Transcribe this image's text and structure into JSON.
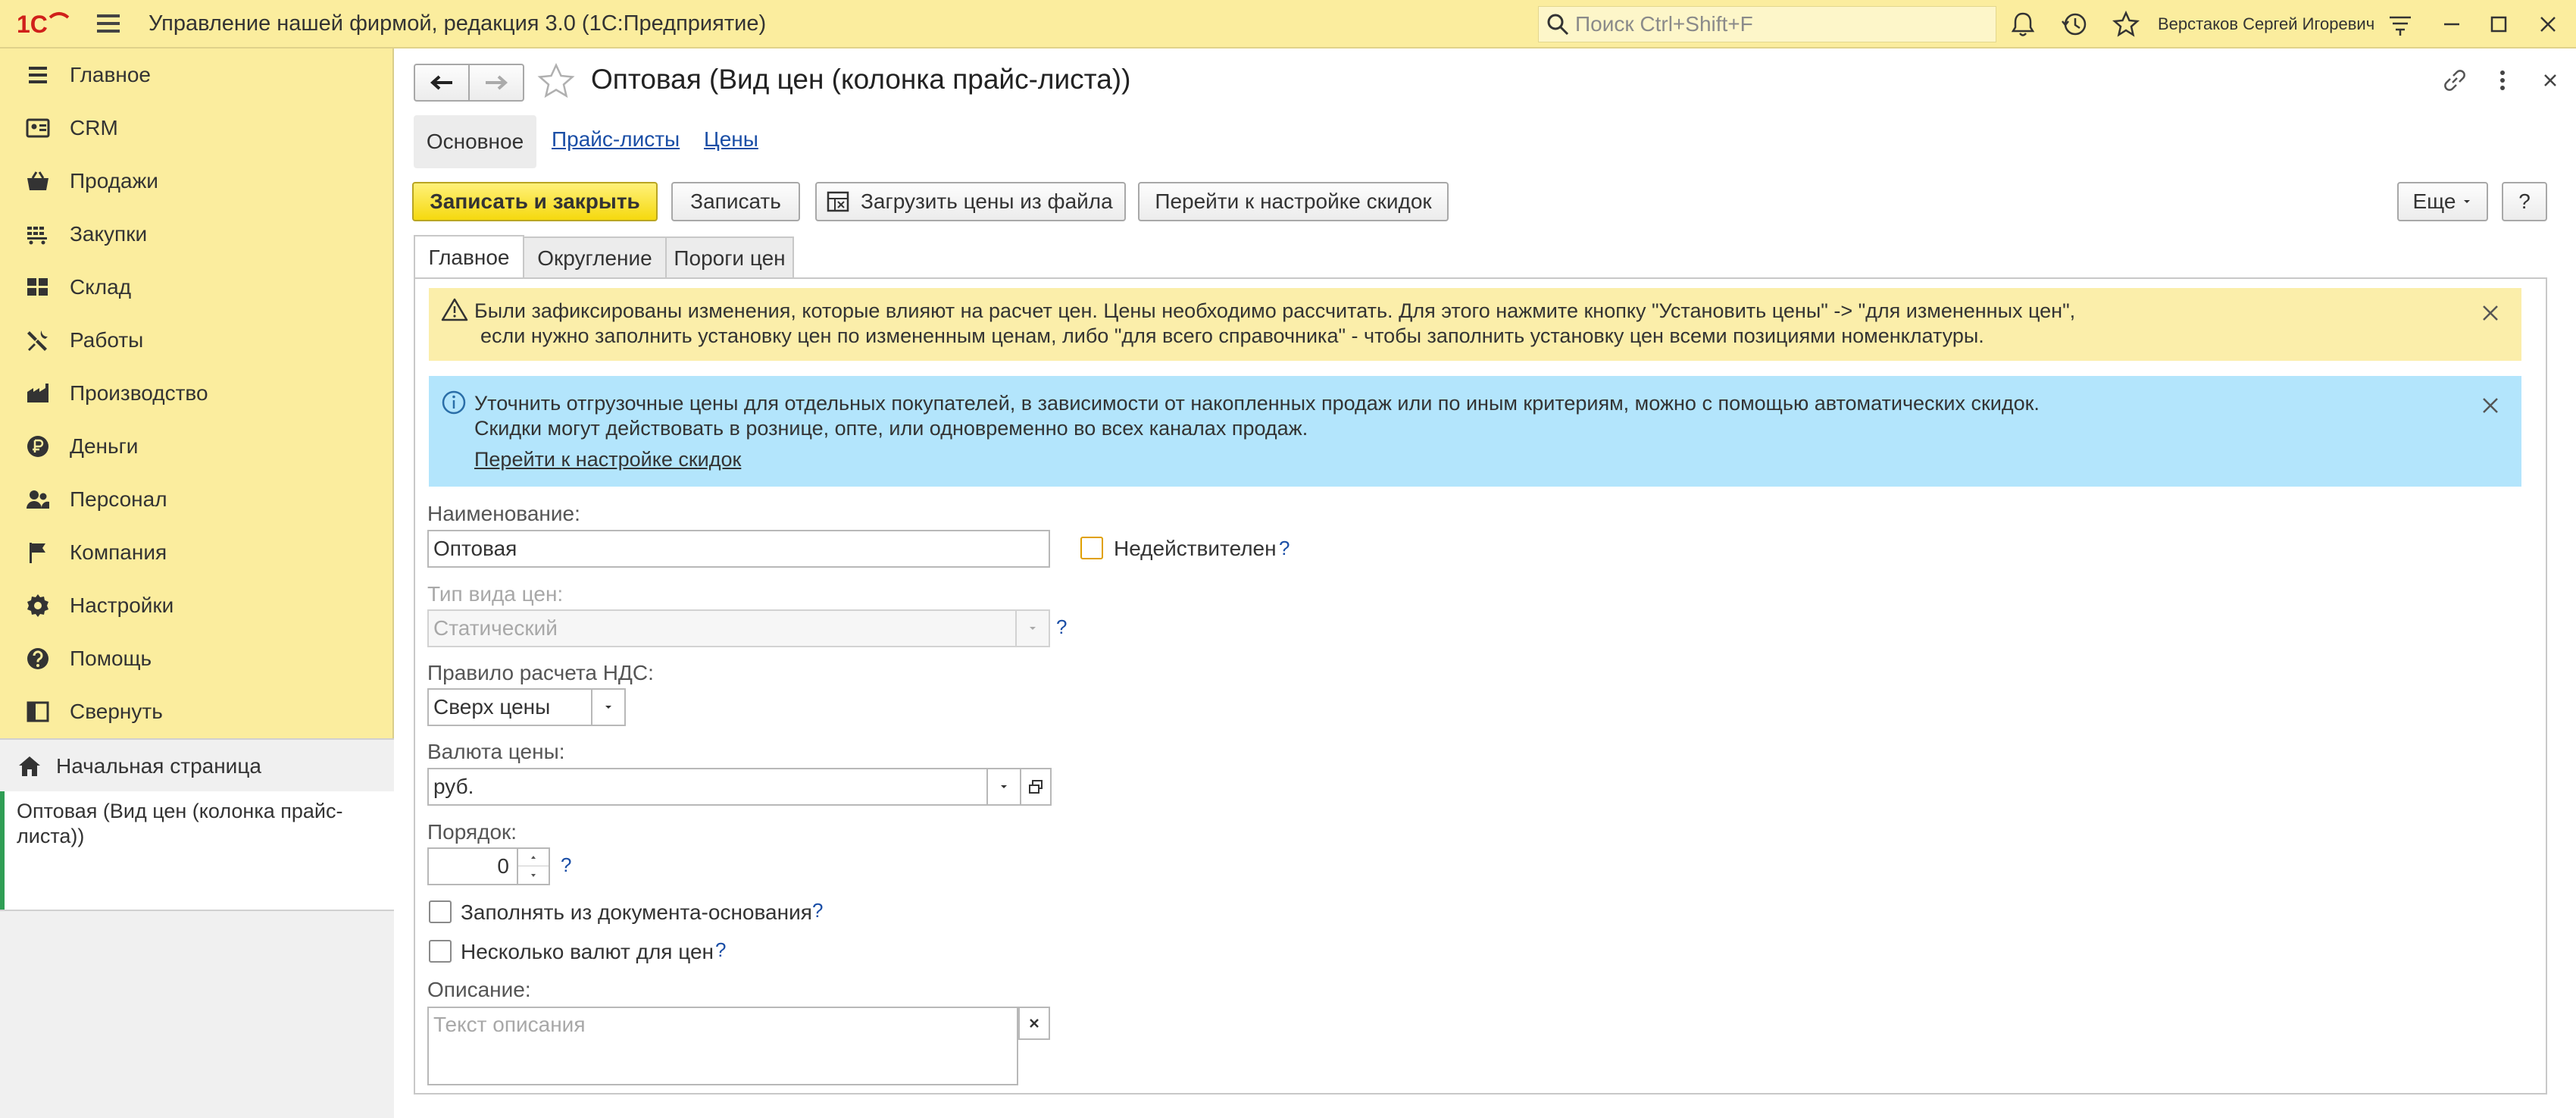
{
  "app": {
    "title": "Управление нашей фирмой, редакция 3.0  (1С:Предприятие)",
    "search_placeholder": "Поиск Ctrl+Shift+F",
    "user": "Верстаков Сергей Игоревич"
  },
  "sidebar": {
    "items": [
      {
        "label": "Главное",
        "icon": "menu-lines-icon"
      },
      {
        "label": "CRM",
        "icon": "crm-icon"
      },
      {
        "label": "Продажи",
        "icon": "basket-icon"
      },
      {
        "label": "Закупки",
        "icon": "cart-icon"
      },
      {
        "label": "Склад",
        "icon": "warehouse-icon"
      },
      {
        "label": "Работы",
        "icon": "tools-icon"
      },
      {
        "label": "Производство",
        "icon": "factory-icon"
      },
      {
        "label": "Деньги",
        "icon": "ruble-icon"
      },
      {
        "label": "Персонал",
        "icon": "people-icon"
      },
      {
        "label": "Компания",
        "icon": "flag-icon"
      },
      {
        "label": "Настройки",
        "icon": "gear-icon"
      },
      {
        "label": "Помощь",
        "icon": "help-icon"
      },
      {
        "label": "Свернуть",
        "icon": "collapse-icon"
      }
    ],
    "home": "Начальная страница",
    "open_window": "Оптовая (Вид цен (колонка прайс-листа))"
  },
  "form": {
    "title": "Оптовая (Вид цен (колонка прайс-листа))",
    "nav_tabs": [
      "Основное",
      "Прайс-листы",
      "Цены"
    ],
    "toolbar": {
      "save_close": "Записать и закрыть",
      "save": "Записать",
      "load_prices": "Загрузить цены из файла",
      "discounts": "Перейти к настройке скидок",
      "more": "Еще",
      "help": "?"
    },
    "tabs": [
      "Главное",
      "Округление",
      "Пороги цен"
    ],
    "warning": {
      "line1": "Были зафиксированы изменения, которые влияют на расчет цен. Цены необходимо рассчитать. Для этого нажмите кнопку \"Установить цены\" -> \"для измененных цен\",",
      "line2": "если нужно заполнить установку цен по измененным ценам,  либо \"для всего справочника\" - чтобы заполнить установку цен всеми позициями номенклатуры."
    },
    "info": {
      "line1": "Уточнить отгрузочные цены для отдельных покупателей, в зависимости от накопленных продаж или по иным критериям, можно с помощью автоматических скидок.",
      "line2": "Скидки могут действовать в рознице, опте, или одновременно во всех каналах продаж.",
      "link": "Перейти к настройке скидок"
    },
    "fields": {
      "name_label": "Наименование:",
      "name_value": "Оптовая",
      "invalid_label": "Недействителен",
      "price_type_label": "Тип вида цен:",
      "price_type_value": "Статический",
      "vat_label": "Правило расчета НДС:",
      "vat_value": "Сверх цены",
      "currency_label": "Валюта цены:",
      "currency_value": "руб.",
      "order_label": "Порядок:",
      "order_value": "0",
      "fill_from_doc": "Заполнять из документа-основания",
      "multi_currency": "Несколько валют для цен",
      "description_label": "Описание:",
      "description_placeholder": "Текст описания"
    },
    "help_mark": "?"
  }
}
